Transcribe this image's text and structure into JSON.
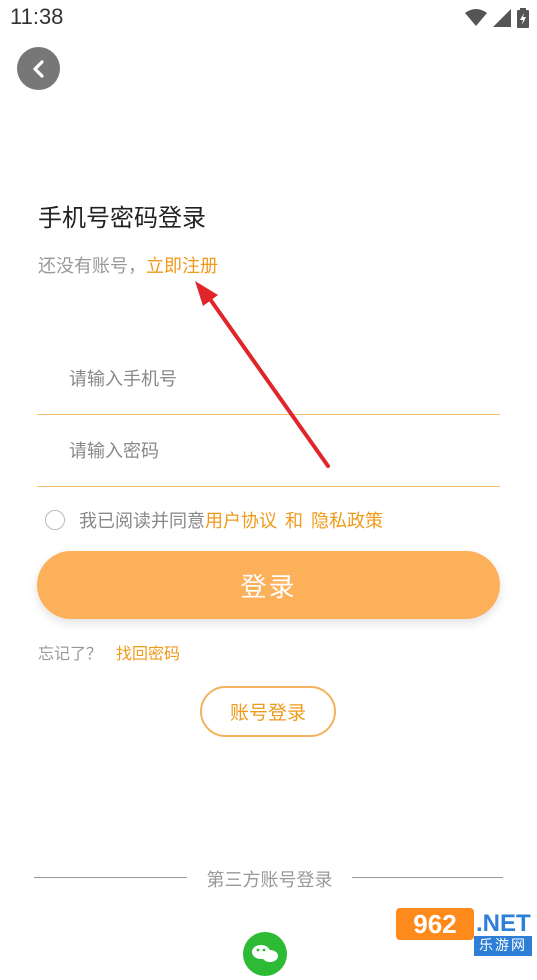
{
  "status_bar": {
    "time": "11:38",
    "icons": [
      "wifi-icon",
      "signal-icon",
      "battery-icon"
    ]
  },
  "header": {
    "back_icon": "chevron-left-icon"
  },
  "login": {
    "title": "手机号密码登录",
    "no_account_text": "还没有账号，",
    "register_link": "立即注册",
    "phone_placeholder": "请输入手机号",
    "phone_value": "",
    "password_placeholder": "请输入密码",
    "password_value": "",
    "agree_text": "我已阅读并同意",
    "user_agreement": "用户协议",
    "and_text": "和",
    "privacy_policy": "隐私政策",
    "login_button": "登录",
    "forgot_text": "忘记了？",
    "recover_link": "找回密码",
    "account_login_button": "账号登录",
    "third_party_label": "第三方账号登录",
    "wechat_icon": "wechat-icon"
  },
  "watermark": {
    "main": "962",
    "suffix": ".NET",
    "cn": "乐游网"
  },
  "colors": {
    "accent": "#ef9a1a",
    "button": "#fdb05a",
    "underline": "#f2c26f",
    "wechat": "#2dbb35",
    "arrow": "#e0262a"
  }
}
